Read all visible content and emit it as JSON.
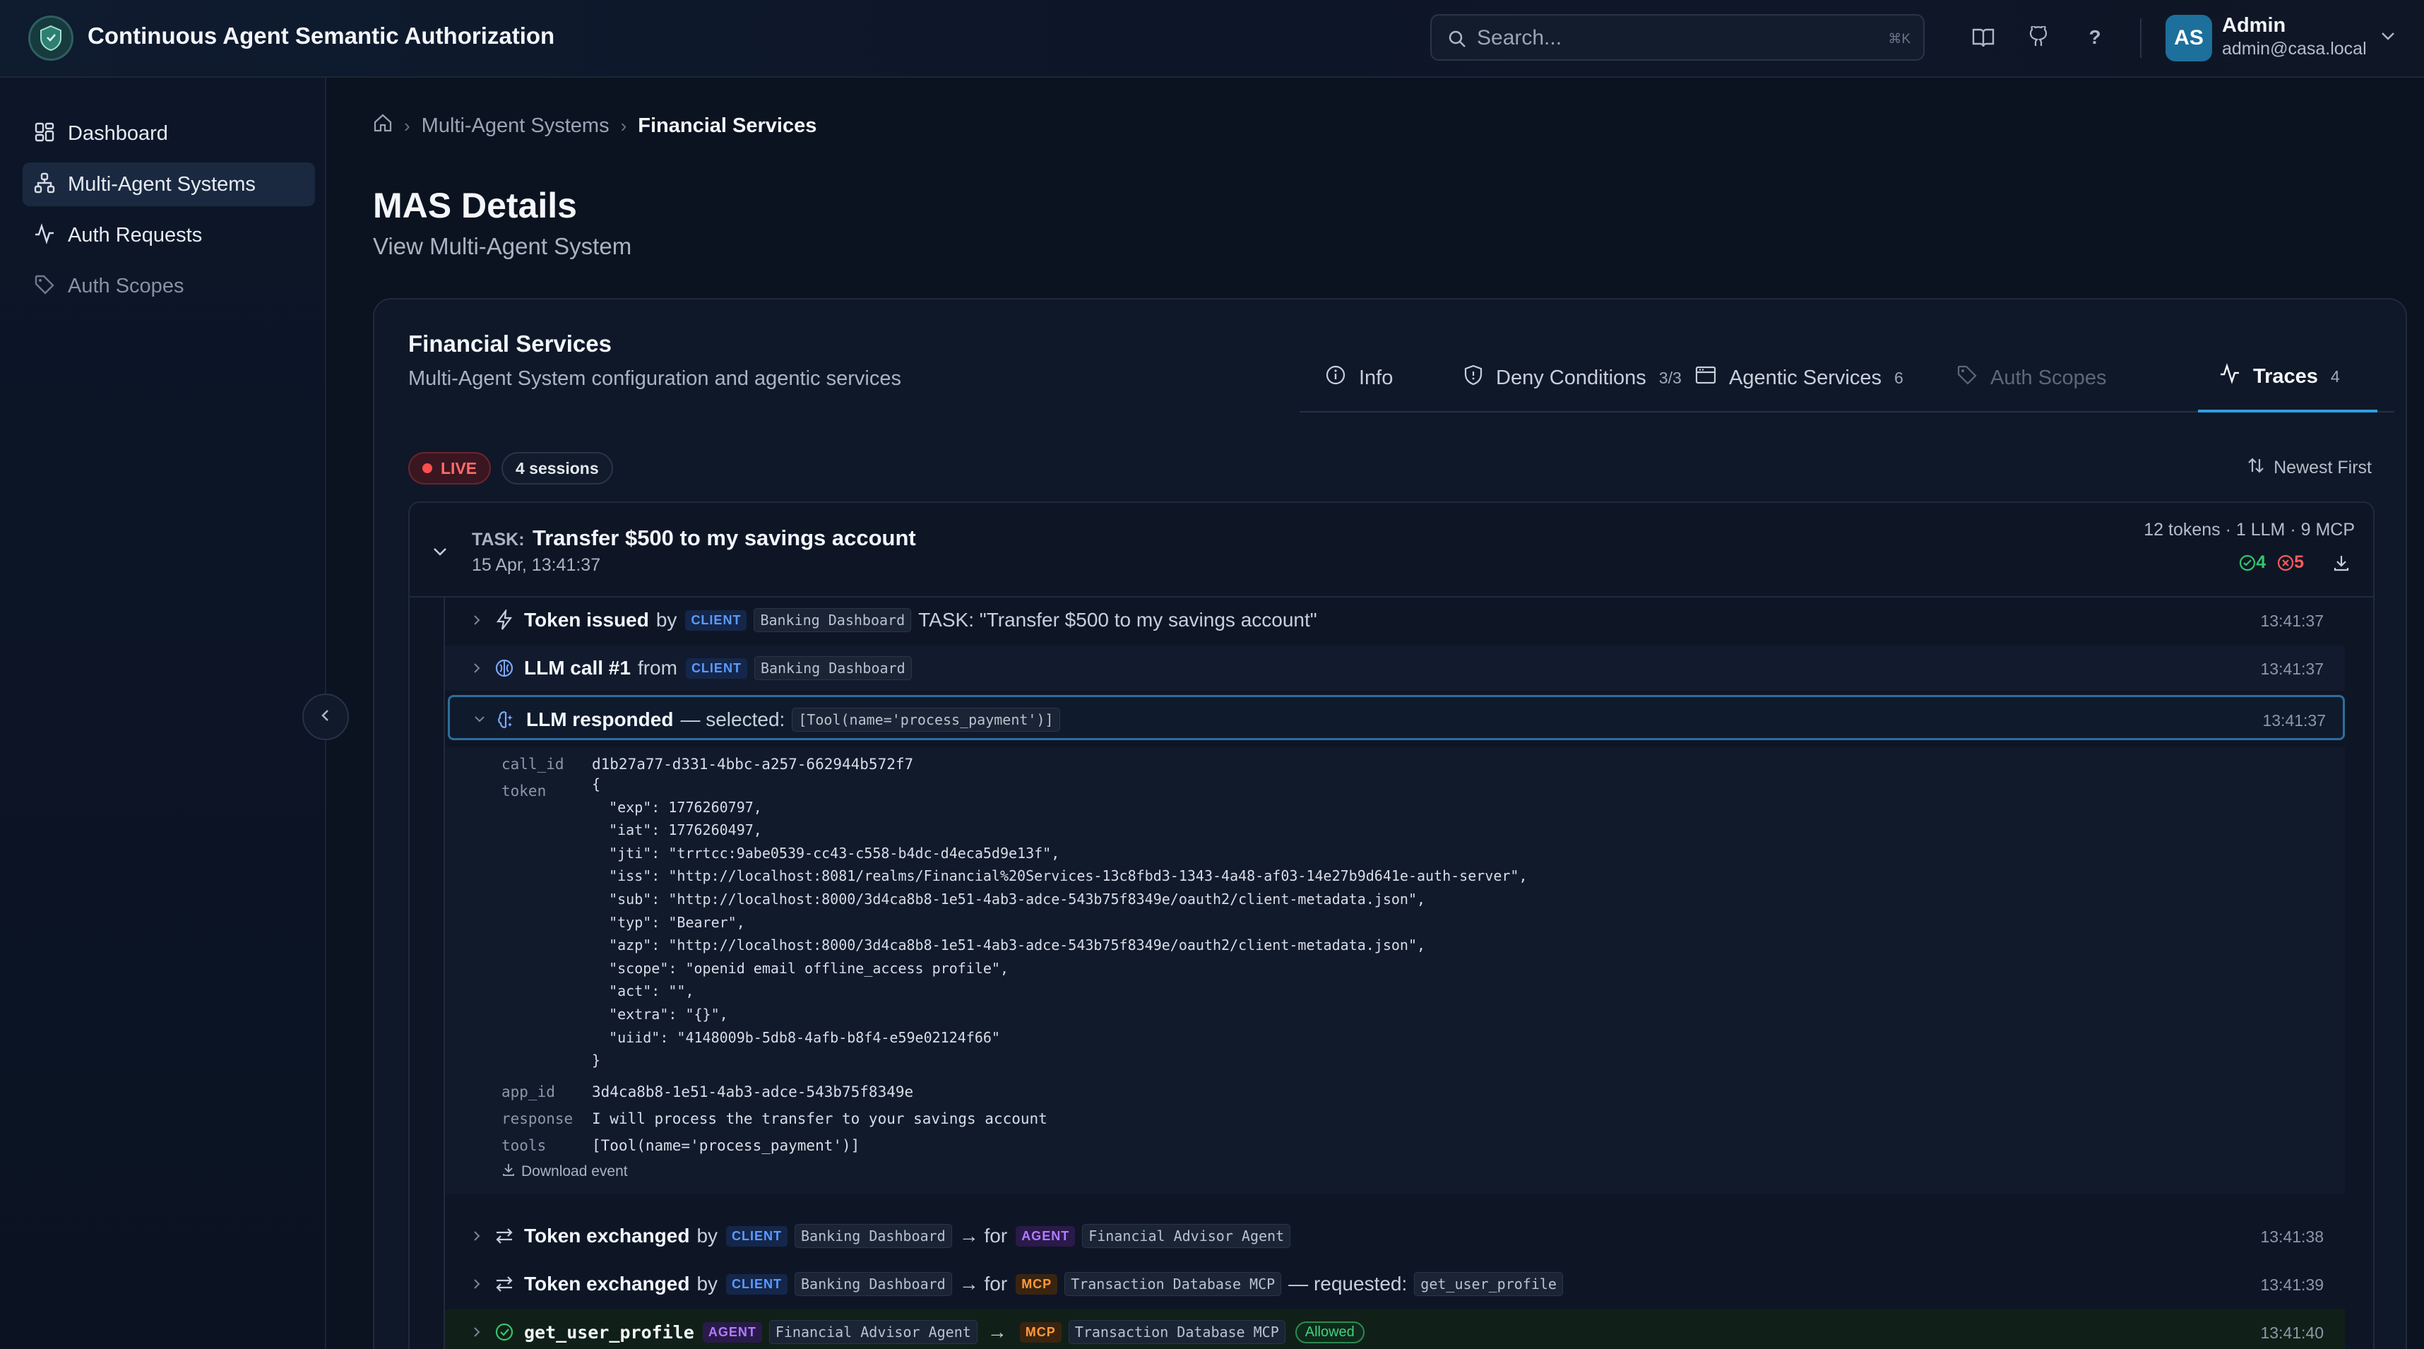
{
  "app": {
    "title": "Continuous Agent Semantic Authorization"
  },
  "header": {
    "search_placeholder": "Search...",
    "search_shortcut": "⌘K",
    "help_label": "?",
    "user": {
      "initials": "AS",
      "name": "Admin",
      "email": "admin@casa.local"
    }
  },
  "sidebar": {
    "items": [
      {
        "label": "Dashboard",
        "icon": "grid-icon"
      },
      {
        "label": "Multi-Agent Systems",
        "icon": "network-icon",
        "active": true
      },
      {
        "label": "Auth Requests",
        "icon": "activity-icon"
      },
      {
        "label": "Auth Scopes",
        "icon": "tag-icon",
        "muted": true
      }
    ]
  },
  "breadcrumb": {
    "items": [
      "Multi-Agent Systems",
      "Financial Services"
    ]
  },
  "page": {
    "title": "MAS Details",
    "subtitle": "View Multi-Agent System"
  },
  "card": {
    "title": "Financial Services",
    "subtitle": "Multi-Agent System configuration and agentic services",
    "tabs": [
      {
        "label": "Info",
        "count": ""
      },
      {
        "label": "Deny Conditions",
        "count": "3/3"
      },
      {
        "label": "Agentic Services",
        "count": "6"
      },
      {
        "label": "Auth Scopes",
        "count": ""
      },
      {
        "label": "Traces",
        "count": "4"
      }
    ]
  },
  "traces": {
    "live_label": "LIVE",
    "sessions_label": "4 sessions",
    "sort_label": "Newest First",
    "session": {
      "task_keyword": "TASK:",
      "task": "Transfer $500 to my savings account",
      "time": "15 Apr, 13:41:37",
      "stats": "12 tokens · 1 LLM · 9 MCP",
      "ok_count": "4",
      "fail_count": "5"
    },
    "events": [
      {
        "title": "Token issued",
        "by": "by",
        "client_badge": "CLIENT",
        "client_name": "Banking Dashboard",
        "extra": "TASK: \"Transfer $500 to my savings account\"",
        "time": "13:41:37"
      },
      {
        "title": "LLM call #1",
        "by": "from",
        "client_badge": "CLIENT",
        "client_name": "Banking Dashboard",
        "time": "13:41:37"
      },
      {
        "title": "LLM responded",
        "extra": "— selected:",
        "tool_chip": "[Tool(name='process_payment')]",
        "time": "13:41:37"
      },
      {
        "title": "Token exchanged",
        "by": "by",
        "client_badge": "CLIENT",
        "client_name": "Banking Dashboard",
        "for": "→ for",
        "target_badge": "AGENT",
        "target_name": "Financial Advisor Agent",
        "time": "13:41:38"
      },
      {
        "title": "Token exchanged",
        "by": "by",
        "client_badge": "CLIENT",
        "client_name": "Banking Dashboard",
        "for": "→ for",
        "target_badge": "MCP",
        "target_name": "Transaction Database MCP",
        "requested": "— requested:",
        "requested_chip": "get_user_profile",
        "time": "13:41:39"
      },
      {
        "title": "get_user_profile",
        "agent_badge": "AGENT",
        "agent_name": "Financial Advisor Agent",
        "arrow": "→",
        "mcp_badge": "MCP",
        "mcp_name": "Transaction Database MCP",
        "status": "Allowed",
        "time": "13:41:40"
      }
    ],
    "detail": {
      "call_id_key": "call_id",
      "call_id": "d1b27a77-d331-4bbc-a257-662944b572f7",
      "token_key": "token",
      "token": "{\n  \"exp\": 1776260797,\n  \"iat\": 1776260497,\n  \"jti\": \"trrtcc:9abe0539-cc43-c558-b4dc-d4eca5d9e13f\",\n  \"iss\": \"http://localhost:8081/realms/Financial%20Services-13c8fbd3-1343-4a48-af03-14e27b9d641e-auth-server\",\n  \"sub\": \"http://localhost:8000/3d4ca8b8-1e51-4ab3-adce-543b75f8349e/oauth2/client-metadata.json\",\n  \"typ\": \"Bearer\",\n  \"azp\": \"http://localhost:8000/3d4ca8b8-1e51-4ab3-adce-543b75f8349e/oauth2/client-metadata.json\",\n  \"scope\": \"openid email offline_access profile\",\n  \"act\": \"\",\n  \"extra\": \"{}\",\n  \"uiid\": \"4148009b-5db8-4afb-b8f4-e59e02124f66\"\n}",
      "app_id_key": "app_id",
      "app_id": "3d4ca8b8-1e51-4ab3-adce-543b75f8349e",
      "response_key": "response",
      "response": "I will process the transfer to your savings account",
      "tools_key": "tools",
      "tools": "[Tool(name='process_payment')]",
      "download_label": "Download event"
    }
  }
}
